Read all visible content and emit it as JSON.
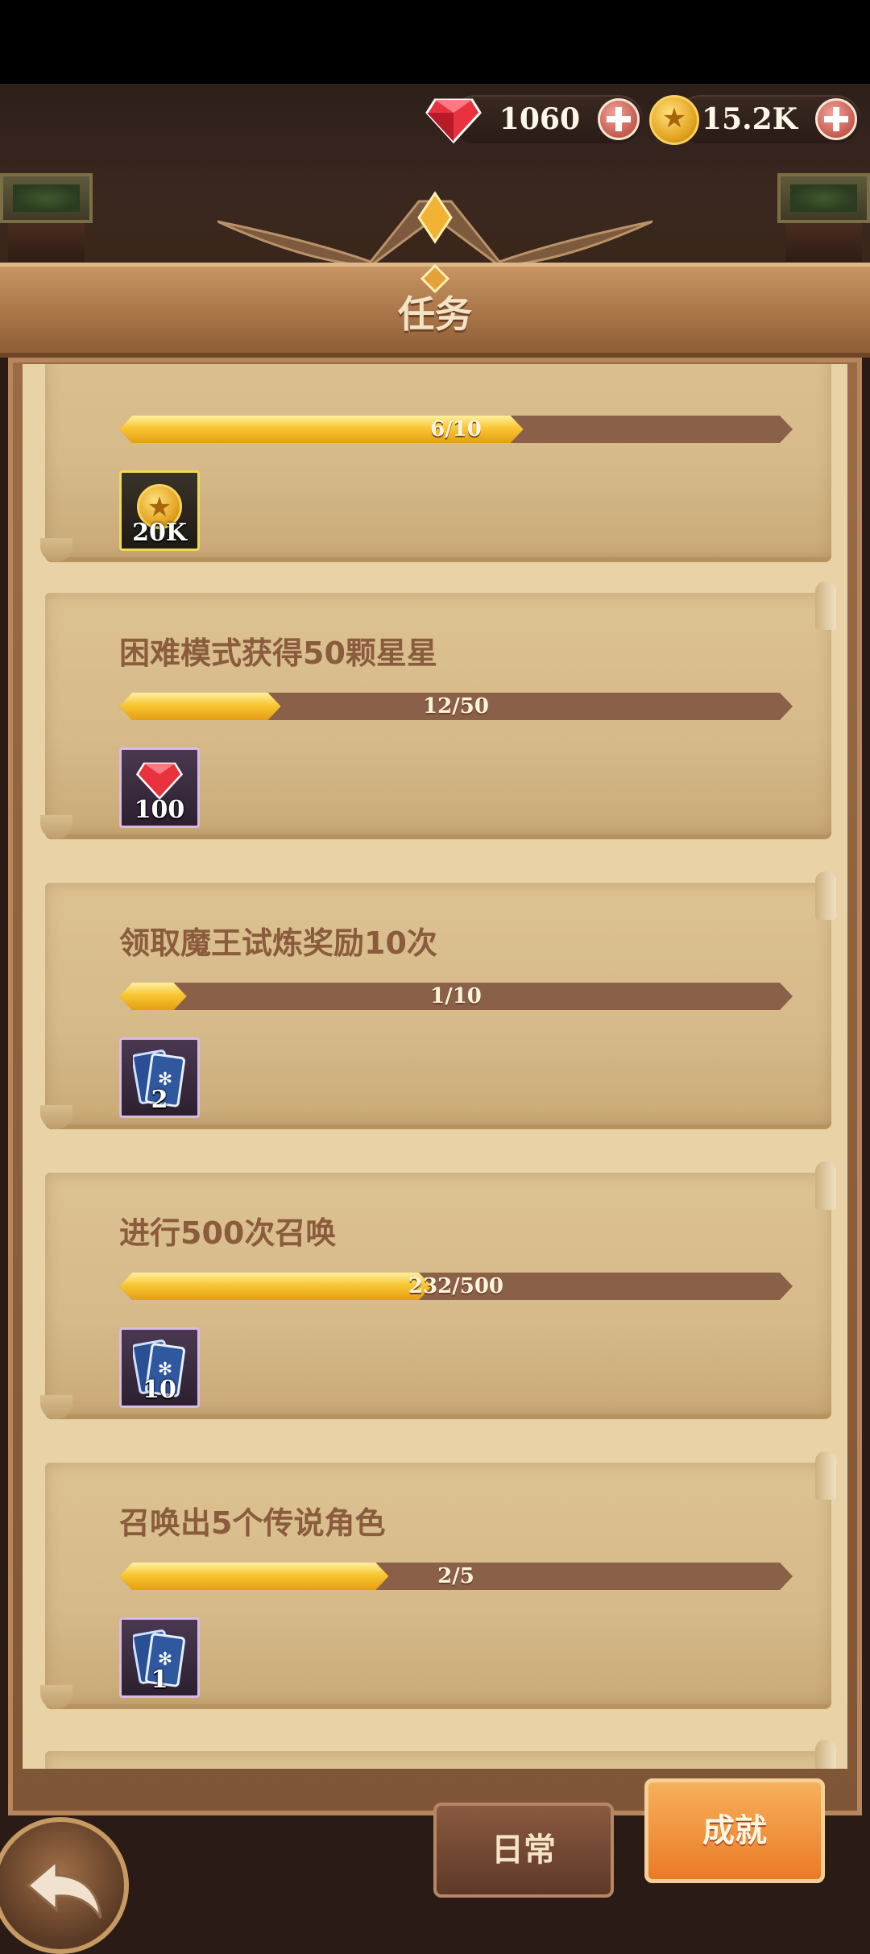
{
  "header": {
    "gems": "1060",
    "coins": "15.2K",
    "title": "任务"
  },
  "tasks": [
    {
      "title": "",
      "progress": "6/10",
      "progress_fraction": 0.6,
      "reward_value": "20K",
      "reward_icon": "gold-coin-icon"
    },
    {
      "title": "困难模式获得50颗星星",
      "progress": "12/50",
      "progress_fraction": 0.24,
      "reward_value": "100",
      "reward_icon": "red-gem-icon"
    },
    {
      "title": "领取魔王试炼奖励10次",
      "progress": "1/10",
      "progress_fraction": 0.1,
      "reward_value": "2",
      "reward_icon": "summon-card-icon"
    },
    {
      "title": "进行500次召唤",
      "progress": "232/500",
      "progress_fraction": 0.464,
      "reward_value": "10",
      "reward_icon": "summon-card-icon"
    },
    {
      "title": "召唤出5个传说角色",
      "progress": "2/5",
      "progress_fraction": 0.4,
      "reward_value": "1",
      "reward_icon": "summon-card-icon"
    }
  ],
  "tabs": {
    "daily": "日常",
    "achievement": "成就"
  },
  "colors": {
    "accent": "#ea7a26",
    "progress_fill": "#f8c632",
    "text_brown": "#8a5c3d"
  }
}
